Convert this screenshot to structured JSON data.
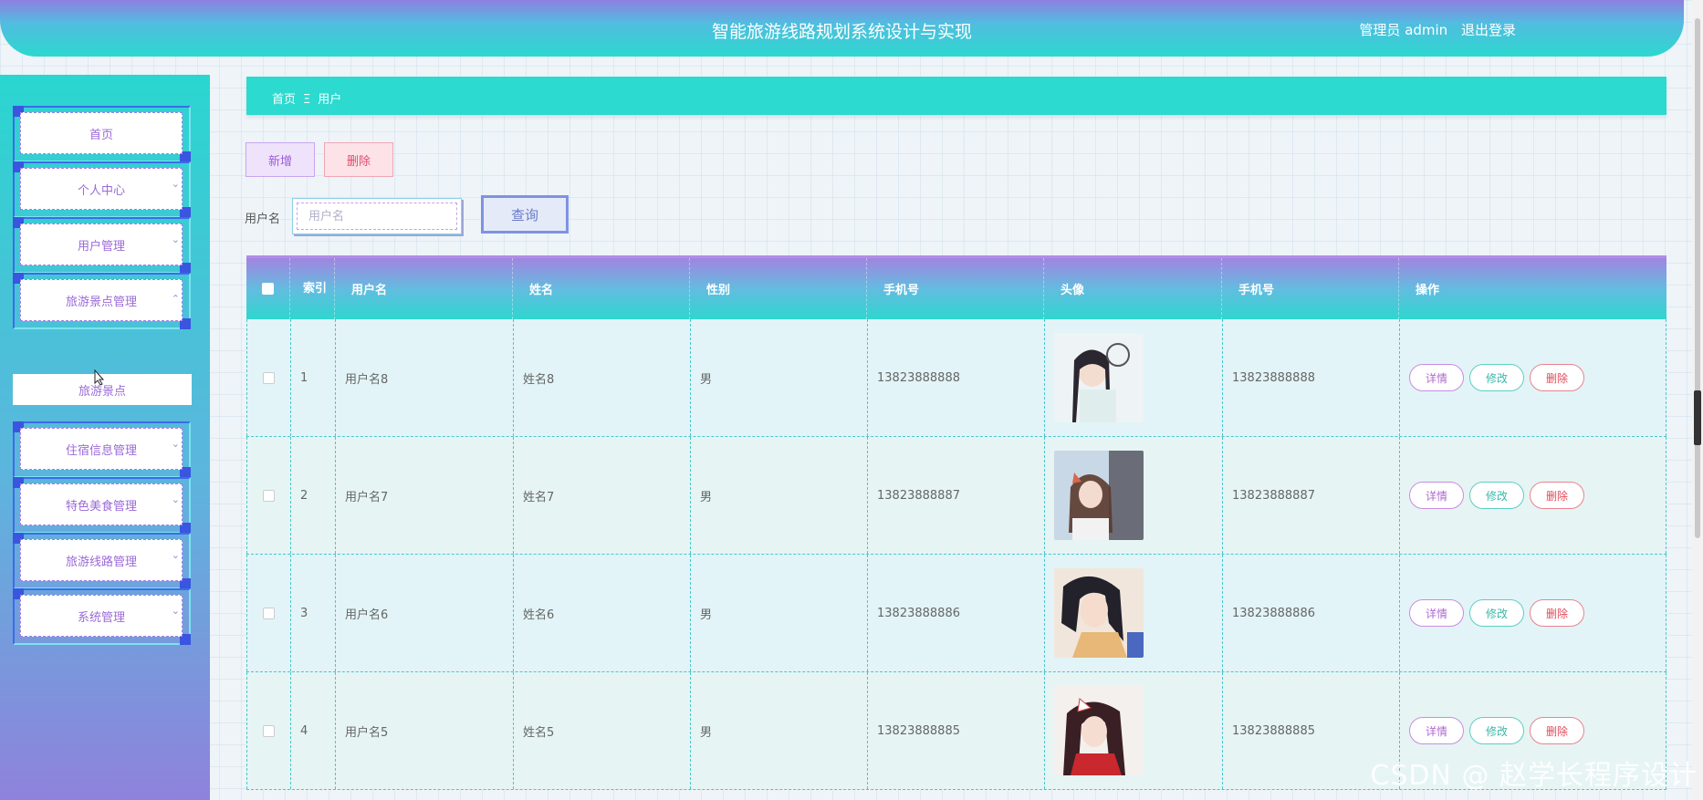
{
  "header": {
    "title": "智能旅游线路规划系统设计与实现",
    "user_role": "管理员 admin",
    "logout": "退出登录"
  },
  "sidebar": {
    "items": [
      {
        "label": "首页"
      },
      {
        "label": "个人中心"
      },
      {
        "label": "用户管理"
      },
      {
        "label": "旅游景点管理"
      },
      {
        "label": "住宿信息管理"
      },
      {
        "label": "特色美食管理"
      },
      {
        "label": "旅游线路管理"
      },
      {
        "label": "系统管理"
      }
    ],
    "submenu": "旅游景点"
  },
  "breadcrumb": {
    "home": "首页",
    "sep": "Ξ",
    "current": "用户"
  },
  "toolbar": {
    "add": "新增",
    "delete": "删除"
  },
  "search": {
    "label": "用户名",
    "placeholder": "用户名",
    "button": "查询"
  },
  "table": {
    "headers": [
      "索引",
      "用户名",
      "姓名",
      "性别",
      "手机号",
      "头像",
      "手机号",
      "操作"
    ],
    "rows": [
      {
        "index": "1",
        "username": "用户名8",
        "name": "姓名8",
        "gender": "男",
        "phone": "13823888888",
        "phone2": "13823888888"
      },
      {
        "index": "2",
        "username": "用户名7",
        "name": "姓名7",
        "gender": "男",
        "phone": "13823888887",
        "phone2": "13823888887"
      },
      {
        "index": "3",
        "username": "用户名6",
        "name": "姓名6",
        "gender": "男",
        "phone": "13823888886",
        "phone2": "13823888886"
      },
      {
        "index": "4",
        "username": "用户名5",
        "name": "姓名5",
        "gender": "男",
        "phone": "13823888885",
        "phone2": "13823888885"
      }
    ],
    "actions": {
      "detail": "详情",
      "edit": "修改",
      "delete": "删除"
    }
  },
  "watermark": "CSDN @ 赵学长程序设计"
}
